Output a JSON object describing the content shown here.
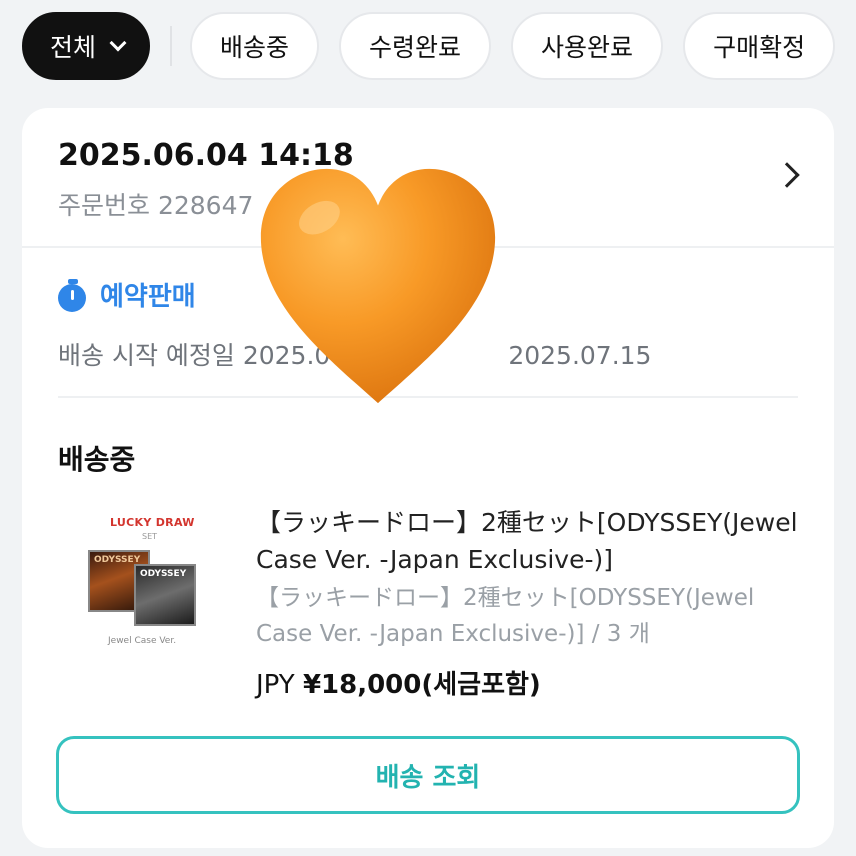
{
  "filters": {
    "active": "전체",
    "items": [
      "배송중",
      "수령완료",
      "사용완료",
      "구매확정"
    ]
  },
  "order": {
    "date": "2025.06.04 14:18",
    "number": "주문번호 228647"
  },
  "reservation": {
    "label": "예약판매",
    "ship_date_text": "배송 시작 예정일 2025.0",
    "ship_date_end": "2025.07.15"
  },
  "shipment": {
    "status": "배송중"
  },
  "product": {
    "image_text_top": "LUCKY DRAW",
    "image_text_set": "SET",
    "image_case_label": "ODYSSEY",
    "image_text_bottom": "Jewel Case Ver.",
    "title": "【ラッキードロー】2種セット[ODYSSEY(Jewel Case Ver. -Japan Exclusive-)]",
    "option": "【ラッキードロー】2種セット[ODYSSEY(Jewel Case Ver. -Japan Exclusive-)] / 3 개",
    "price_currency": "JPY",
    "price_value": "¥18,000(세금포함)"
  },
  "actions": {
    "track_label": "배송 조회"
  },
  "colors": {
    "accent_blue": "#2f86e8",
    "accent_teal": "#35c2bf",
    "heart_orange": "#f38a1c"
  },
  "icons": {
    "filter_chevron": "chevron-down-icon",
    "order_arrow": "chevron-right-icon",
    "reservation": "timer-icon",
    "overlay": "orange-heart-emoji"
  }
}
